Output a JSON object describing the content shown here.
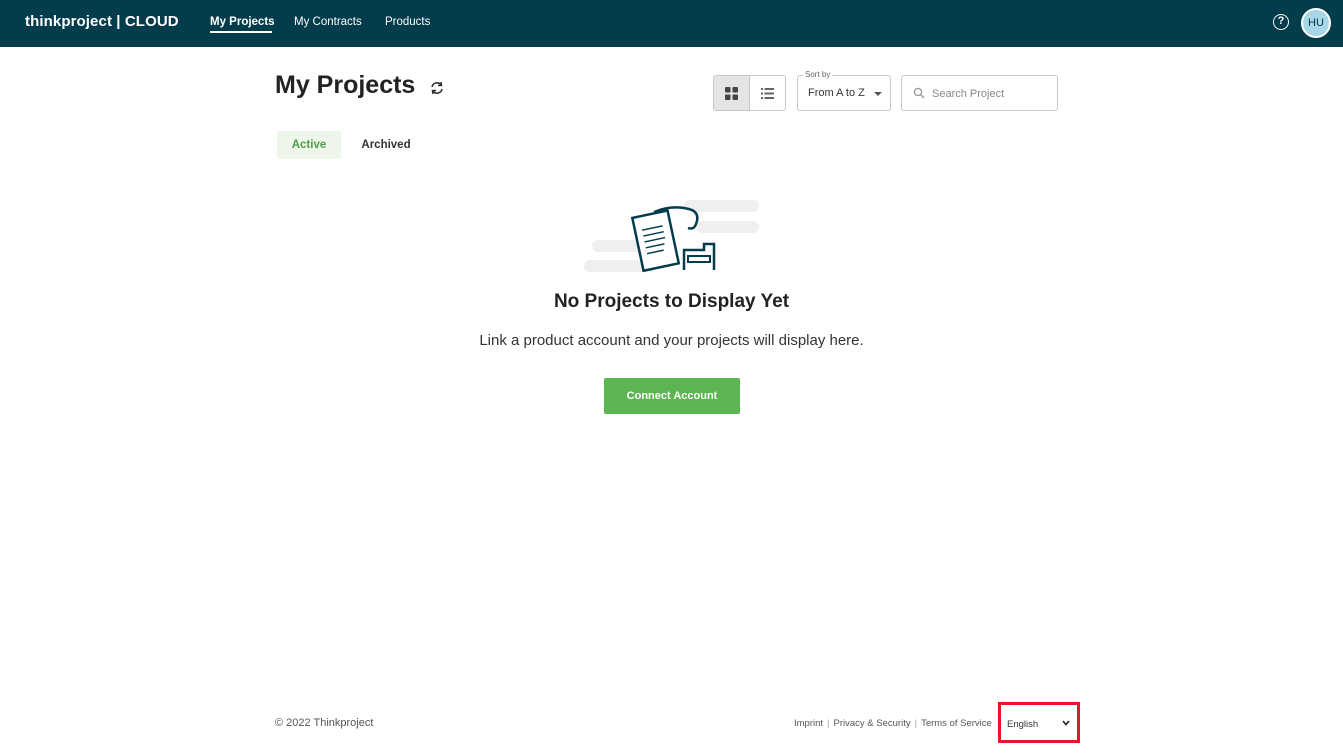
{
  "topbar": {
    "brand": "thinkproject | CLOUD",
    "nav": [
      {
        "label": "My Projects",
        "active": true
      },
      {
        "label": "My Contracts",
        "active": false
      },
      {
        "label": "Products",
        "active": false
      }
    ],
    "help_icon": "question-circle-icon",
    "avatar_initials": "HU"
  },
  "header": {
    "title": "My Projects",
    "refresh_icon": "refresh-icon",
    "view_modes": [
      "grid-view-icon",
      "list-view-icon"
    ],
    "sort": {
      "label": "Sort by",
      "value": "From A to Z"
    },
    "search": {
      "placeholder": "Search Project",
      "value": ""
    }
  },
  "tabs": [
    {
      "label": "Active",
      "active": true
    },
    {
      "label": "Archived",
      "active": false
    }
  ],
  "empty_state": {
    "title": "No Projects to Display Yet",
    "description": "Link a product account and your projects will display here.",
    "button": "Connect Account"
  },
  "footer": {
    "copyright": "© 2022 Thinkproject",
    "links": [
      "Imprint",
      "Privacy & Security",
      "Terms of Service"
    ],
    "language": "English"
  },
  "colors": {
    "topbar": "#033c4b",
    "accent_green": "#5bb550",
    "active_tab_text": "#4c9c44",
    "highlight_box": "#e0192a"
  }
}
